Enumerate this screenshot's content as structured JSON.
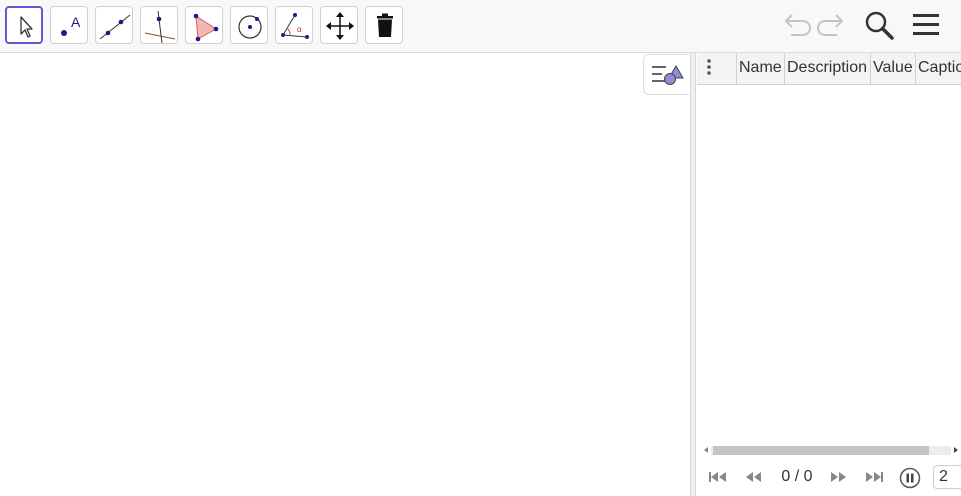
{
  "toolbar": {
    "tools": [
      {
        "name": "move-tool",
        "active": true
      },
      {
        "name": "point-tool",
        "label": "A"
      },
      {
        "name": "line-tool"
      },
      {
        "name": "perpendicular-line-tool"
      },
      {
        "name": "polygon-tool"
      },
      {
        "name": "circle-center-point-tool"
      },
      {
        "name": "angle-tool",
        "label": "α"
      },
      {
        "name": "move-graphics-view-tool"
      },
      {
        "name": "delete-tool"
      }
    ],
    "right_icons": [
      "undo-icon",
      "redo-icon",
      "search-icon",
      "menu-icon"
    ]
  },
  "algebra": {
    "columns": [
      "Name",
      "Description",
      "Value",
      "Caption"
    ]
  },
  "playbar": {
    "counter": "0 / 0",
    "speed": "2"
  },
  "colors": {
    "accent": "#6557d2",
    "point": "#1a1a8c",
    "line": "#1f1f6e",
    "polygon_fill": "#f4b5b5",
    "polygon_stroke": "#d06060"
  }
}
